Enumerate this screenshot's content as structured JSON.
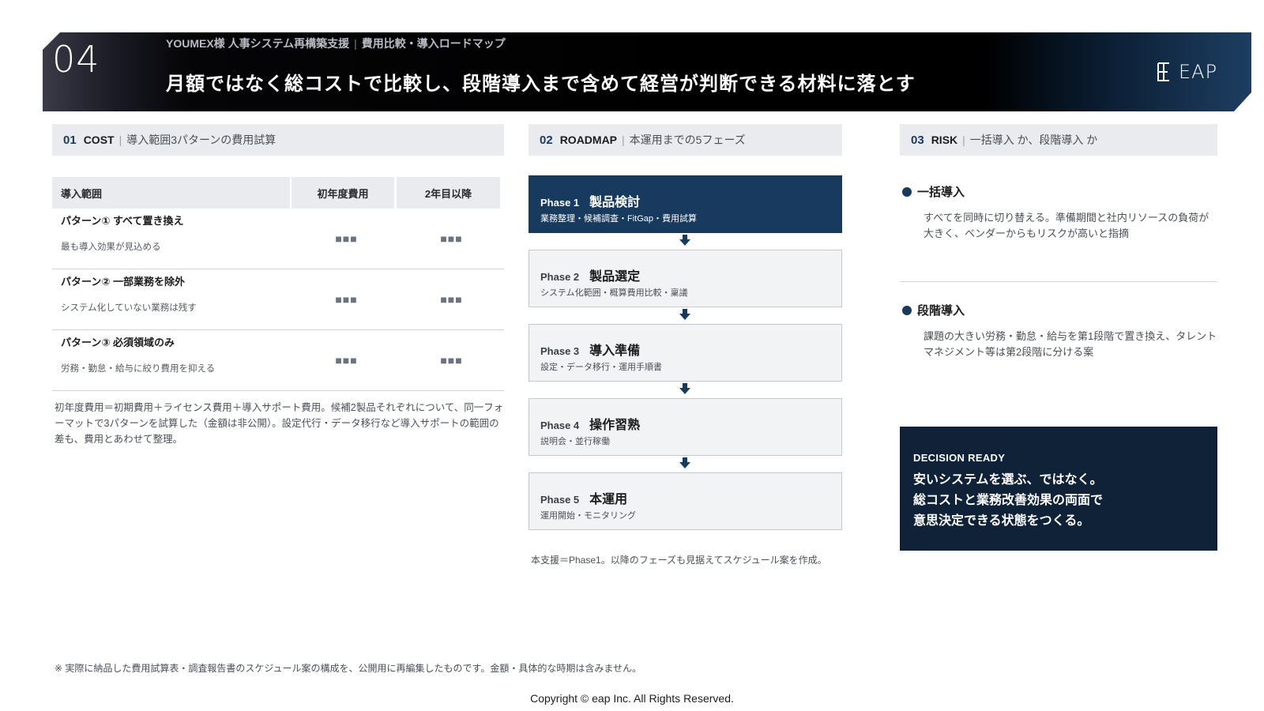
{
  "header": {
    "number": "04",
    "subtitle_client": "YOUMEX様 人事システム再構築支援",
    "subtitle_topic": "費用比較・導入ロードマップ",
    "title": "月額ではなく総コストで比較し、段階導入まで含めて経営が判断できる材料に落とす",
    "logo_text": "EAP",
    "logo_icon": "eap-logo-icon"
  },
  "cost": {
    "num": "01",
    "key": "COST",
    "desc": "導入範囲3パターンの費用試算",
    "columns": [
      "導入範囲",
      "初年度費用",
      "2年目以降"
    ],
    "rows": [
      {
        "title": "パターン① すべて置き換え",
        "sub": "最も導入効果が見込める",
        "first_year": "■■■",
        "later": "■■■"
      },
      {
        "title": "パターン② 一部業務を除外",
        "sub": "システム化していない業務は残す",
        "first_year": "■■■",
        "later": "■■■"
      },
      {
        "title": "パターン③ 必須領域のみ",
        "sub": "労務・勤怠・給与に絞り費用を抑える",
        "first_year": "■■■",
        "later": "■■■"
      }
    ],
    "note": "初年度費用＝初期費用＋ライセンス費用＋導入サポート費用。候補2製品それぞれについて、同一フォーマットで3パターンを試算した（金額は非公開）。設定代行・データ移行など導入サポートの範囲の差も、費用とあわせて整理。"
  },
  "roadmap": {
    "num": "02",
    "key": "ROADMAP",
    "desc": "本運用までの5フェーズ",
    "phases": [
      {
        "label": "Phase 1",
        "name": "製品検討",
        "desc": "業務整理・候補調査・FitGap・費用試算"
      },
      {
        "label": "Phase 2",
        "name": "製品選定",
        "desc": "システム化範囲・概算費用比較・稟議"
      },
      {
        "label": "Phase 3",
        "name": "導入準備",
        "desc": "設定・データ移行・運用手順書"
      },
      {
        "label": "Phase 4",
        "name": "操作習熟",
        "desc": "説明会・並行稼働"
      },
      {
        "label": "Phase 5",
        "name": "本運用",
        "desc": "運用開始・モニタリング"
      }
    ],
    "note": "本支援＝Phase1。以降のフェーズも見据えてスケジュール案を作成。"
  },
  "risk": {
    "num": "03",
    "key": "RISK",
    "desc": "一括導入 か、段階導入 か",
    "items": [
      {
        "title": "一括導入",
        "desc": "すべてを同時に切り替える。準備期間と社内リソースの負荷が大きく、ベンダーからもリスクが高いと指摘"
      },
      {
        "title": "段階導入",
        "desc": "課題の大きい労務・勤怠・給与を第1段階で置き換え、タレントマネジメント等は第2段階に分ける案"
      }
    ],
    "decision": {
      "heading": "DECISION READY",
      "lines": [
        "安いシステムを選ぶ、ではなく。",
        "総コストと業務改善効果の両面で",
        "意思決定できる状態をつくる。"
      ]
    }
  },
  "footer": {
    "footnote": "※ 実際に納品した費用試算表・調査報告書のスケジュール案の構成を、公開用に再編集したものです。金額・具体的な時期は含みません。",
    "copyright": "Copyright © eap Inc. All Rights Reserved."
  },
  "colors": {
    "navy": "#173a5e",
    "dark_navy": "#0f2238",
    "panel_gray": "#e9ebee",
    "phase_gray": "#f2f3f5",
    "placeholder_block": "#6b7280"
  }
}
